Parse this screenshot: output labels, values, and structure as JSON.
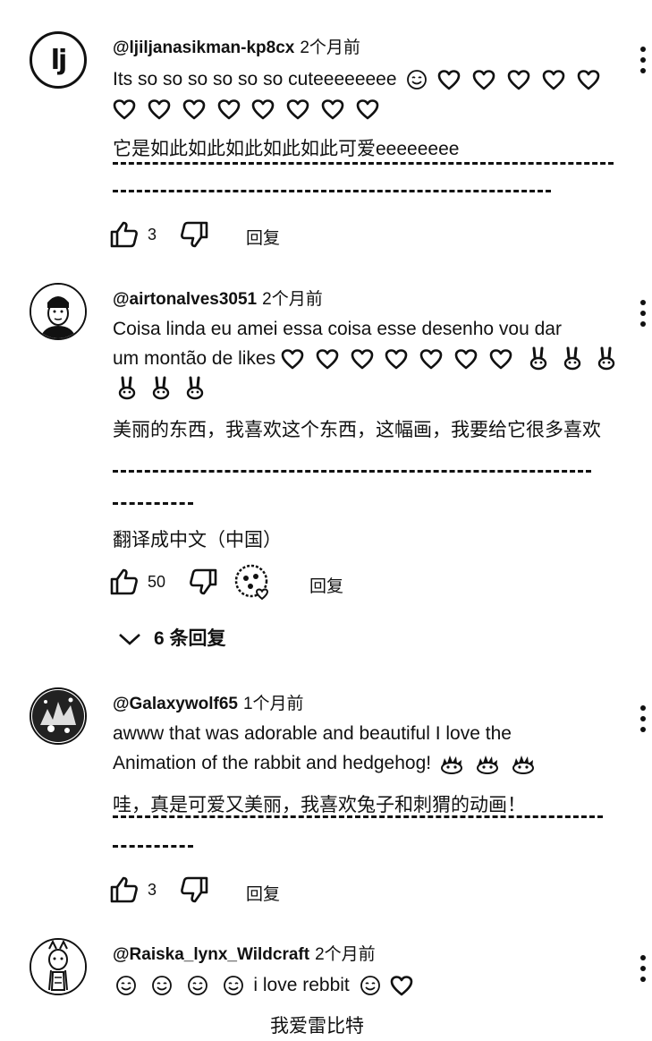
{
  "comments": [
    {
      "handle": "@ljiljanasikman-kp8cx",
      "time": "2个月前",
      "avatar_text": "lj",
      "text": "Its so so so so so so cuteeeeeeee",
      "translation": "它是如此如此如此如此如此可爱eeeeeeee",
      "likes": "3",
      "reply_label": "回复"
    },
    {
      "handle": "@airtonalves3051",
      "time": "2个月前",
      "text_line1": "Coisa linda eu amei essa coisa esse desenho vou dar",
      "text_line2": "um montão de likes",
      "translation": "美丽的东西，我喜欢这个东西，这幅画，我要给它很多喜欢",
      "translate_link": "翻译成中文（中国）",
      "likes": "50",
      "reply_label": "回复",
      "replies_toggle": "6 条回复"
    },
    {
      "handle": "@Galaxywolf65",
      "time": "1个月前",
      "text_line1": "awww that was adorable and beautiful I love the",
      "text_line2": "Animation of the rabbit and hedgehog!",
      "translation": "哇，真是可爱又美丽，我喜欢兔子和刺猬的动画！",
      "likes": "3",
      "reply_label": "回复"
    },
    {
      "handle": "@Raiska_lynx_Wildcraft",
      "time": "2个月前",
      "text": "i love rebbit",
      "translation": "我爱雷比特"
    }
  ],
  "icons": {
    "more": "more-vert-icon",
    "like": "thumb-up-icon",
    "dislike": "thumb-down-icon",
    "expand": "chevron-down-icon",
    "heart": "heart-emoji",
    "smile": "smile-emoji",
    "rabbit": "rabbit-emoji",
    "hedgehog": "hedgehog-emoji"
  }
}
